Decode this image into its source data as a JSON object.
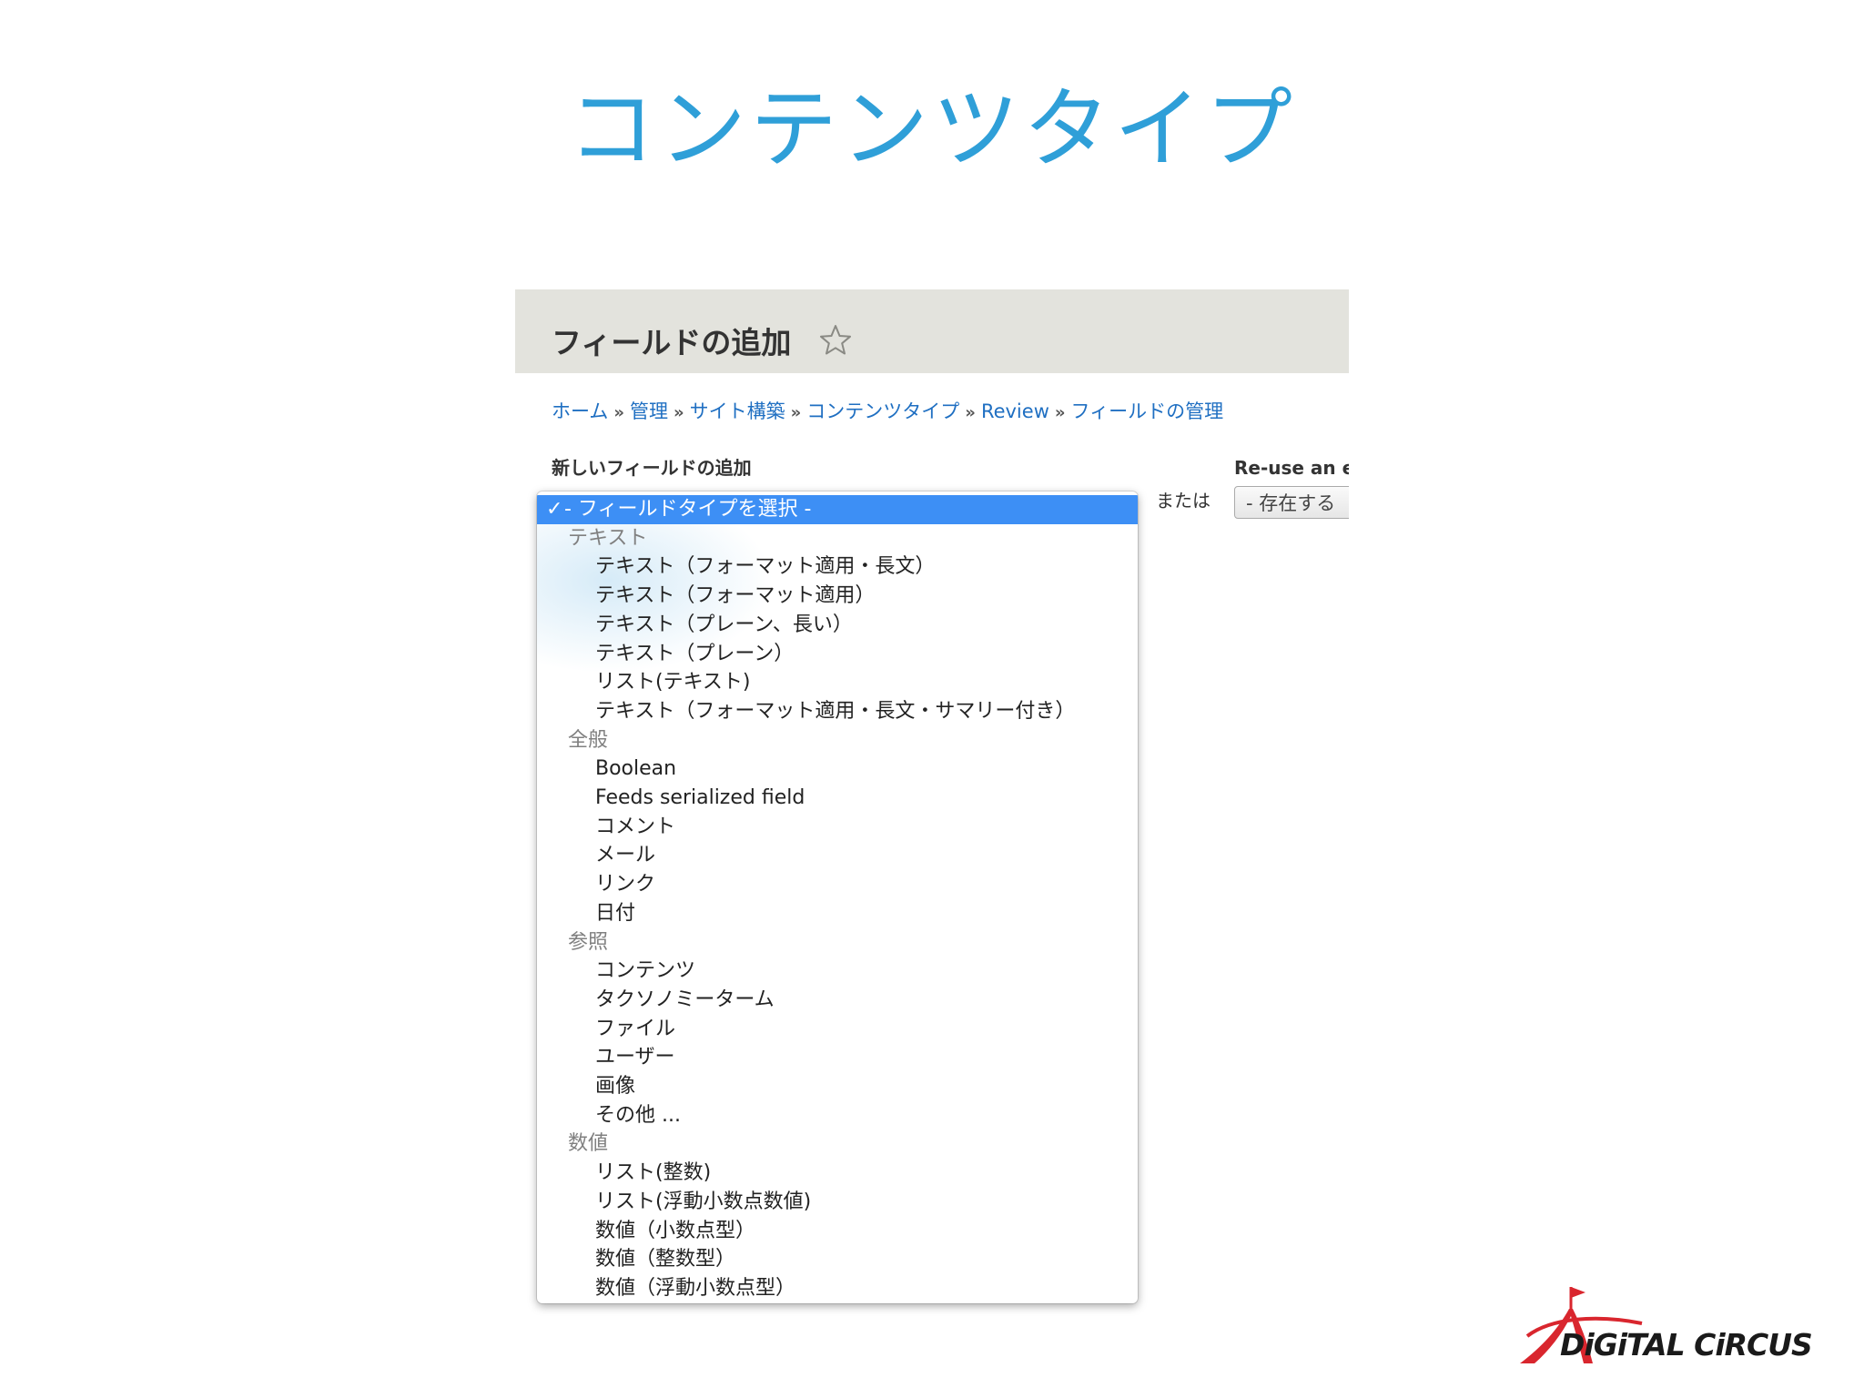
{
  "slide": {
    "title": "コンテンツタイプ",
    "title_color": "#2f9fd8"
  },
  "page": {
    "title": "フィールドの追加",
    "star_icon": "star-outline-icon"
  },
  "breadcrumb": {
    "link_color": "#1f6fc2",
    "separator": "»",
    "items": [
      "ホーム",
      "管理",
      "サイト構築",
      "コンテンツタイプ",
      "Review",
      "フィールドの管理"
    ]
  },
  "form": {
    "new_field_label": "新しいフィールドの追加",
    "or_label": "または",
    "reuse_label": "Re-use an e",
    "reuse_select_value": "- 存在する"
  },
  "dropdown": {
    "highlight_color": "#3d8ff5",
    "selected": "- フィールドタイプを選択 -",
    "groups": [
      {
        "label": "テキスト",
        "items": [
          "テキスト（フォーマット適用・長文）",
          "テキスト（フォーマット適用）",
          "テキスト（プレーン、長い）",
          "テキスト（プレーン）",
          "リスト(テキスト)",
          "テキスト（フォーマット適用・長文・サマリー付き）"
        ]
      },
      {
        "label": "全般",
        "items": [
          "Boolean",
          "Feeds serialized field",
          "コメント",
          "メール",
          "リンク",
          "日付"
        ]
      },
      {
        "label": "参照",
        "items": [
          "コンテンツ",
          "タクソノミーターム",
          "ファイル",
          "ユーザー",
          "画像",
          "その他 ..."
        ]
      },
      {
        "label": "数値",
        "items": [
          "リスト(整数)",
          "リスト(浮動小数点数値)",
          "数値（小数点型）",
          "数値（整数型）",
          "数値（浮動小数点型）"
        ]
      }
    ]
  },
  "logo": {
    "text": "DiGiTAL CiRCUS",
    "color": "#d9262e"
  }
}
